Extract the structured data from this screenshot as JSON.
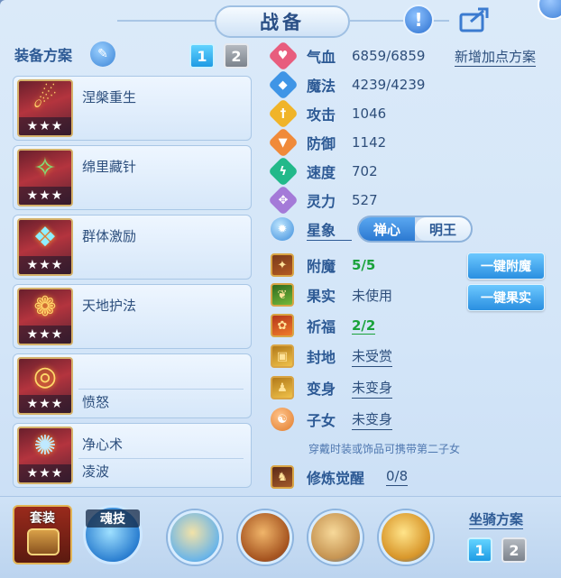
{
  "header": {
    "title": "战备"
  },
  "left_panel": {
    "title": "装备方案",
    "pages": [
      "1",
      "2"
    ],
    "skills": [
      {
        "name": "涅槃重生",
        "sub": "",
        "stars": "★★★"
      },
      {
        "name": "绵里藏针",
        "sub": "",
        "stars": "★★★"
      },
      {
        "name": "群体激励",
        "sub": "",
        "stars": "★★★"
      },
      {
        "name": "天地护法",
        "sub": "",
        "stars": "★★★"
      },
      {
        "name": "",
        "sub": "愤怒",
        "stars": "★★★"
      },
      {
        "name": "净心术",
        "sub": "凌波",
        "stars": "★★★"
      }
    ]
  },
  "stats": {
    "add_plan": "新增加点方案",
    "items": [
      {
        "label": "气血",
        "value": "6859/6859",
        "color": "#e85d7e",
        "icon": "heart-icon",
        "glyph": "♥"
      },
      {
        "label": "魔法",
        "value": "4239/4239",
        "color": "#3f95e6",
        "icon": "mana-icon",
        "glyph": "◆"
      },
      {
        "label": "攻击",
        "value": "1046",
        "color": "#f0b429",
        "icon": "sword-icon",
        "glyph": "†"
      },
      {
        "label": "防御",
        "value": "1142",
        "color": "#f08a3a",
        "icon": "shield-icon",
        "glyph": "▼"
      },
      {
        "label": "速度",
        "value": "702",
        "color": "#22b98a",
        "icon": "speed-icon",
        "glyph": "ϟ"
      },
      {
        "label": "灵力",
        "value": "527",
        "color": "#a47ad8",
        "icon": "spirit-icon",
        "glyph": "✥"
      }
    ],
    "star_label": "星象",
    "star_options": [
      "禅心",
      "明王"
    ]
  },
  "extras": {
    "fumo": {
      "label": "附魔",
      "value": "5/5"
    },
    "guoshi": {
      "label": "果实",
      "value": "未使用"
    },
    "qifu": {
      "label": "祈福",
      "value": "2/2"
    },
    "fengdi": {
      "label": "封地",
      "value": "未受赏"
    },
    "bianshen": {
      "label": "变身",
      "value": "未变身"
    },
    "zinv": {
      "label": "子女",
      "value": "未变身"
    },
    "hint": "穿戴时装或饰品可携带第二子女",
    "xiulian": {
      "label": "修炼觉醒",
      "value": "0/8"
    },
    "btn_fumo": "一键附魔",
    "btn_guoshi": "一键果实"
  },
  "bottom": {
    "set_label": "套装",
    "soul_label": "魂技",
    "ride_label": "坐骑方案",
    "ride_pages": [
      "1",
      "2"
    ]
  }
}
